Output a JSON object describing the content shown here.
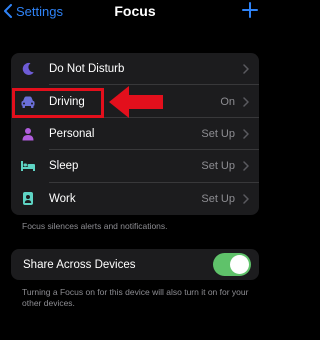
{
  "nav": {
    "back_label": "Settings",
    "title": "Focus"
  },
  "focus_items": [
    {
      "label": "Do Not Disturb",
      "value": "",
      "icon": "moon-icon",
      "icon_color": "#6e5cd6"
    },
    {
      "label": "Driving",
      "value": "On",
      "icon": "car-icon",
      "icon_color": "#6b6fd8"
    },
    {
      "label": "Personal",
      "value": "Set Up",
      "icon": "person-icon",
      "icon_color": "#b05ddc"
    },
    {
      "label": "Sleep",
      "value": "Set Up",
      "icon": "bed-icon",
      "icon_color": "#5ed4c4"
    },
    {
      "label": "Work",
      "value": "Set Up",
      "icon": "badge-icon",
      "icon_color": "#5ed4c4"
    }
  ],
  "focus_footer": "Focus silences alerts and notifications.",
  "share": {
    "label": "Share Across Devices",
    "toggle_on": true,
    "footer": "Turning a Focus on for this device will also turn it on for your other devices."
  },
  "colors": {
    "accent_blue": "#2f83f7",
    "toggle_green": "#5fc26a",
    "annotation_red": "#e30f1c"
  }
}
